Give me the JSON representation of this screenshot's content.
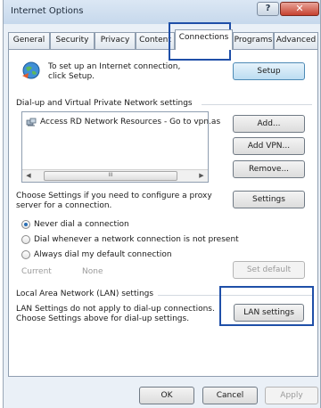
{
  "window": {
    "title": "Internet Options",
    "help_glyph": "?",
    "close_glyph": "✕"
  },
  "tabs": [
    {
      "label": "General"
    },
    {
      "label": "Security"
    },
    {
      "label": "Privacy"
    },
    {
      "label": "Content"
    },
    {
      "label": "Connections"
    },
    {
      "label": "Programs"
    },
    {
      "label": "Advanced"
    }
  ],
  "setup": {
    "text": "To set up an Internet connection, click Setup.",
    "button": "Setup"
  },
  "dialup": {
    "heading": "Dial-up and Virtual Private Network settings",
    "list_item": "Access RD Network Resources - Go to vpn.as",
    "scroll_thumb": "III",
    "add_button": "Add...",
    "add_vpn_button": "Add VPN...",
    "remove_button": "Remove...",
    "proxy_text": "Choose Settings if you need to configure a proxy server for a connection.",
    "settings_button": "Settings"
  },
  "radios": [
    {
      "label": "Never dial a connection",
      "checked": true
    },
    {
      "label": "Dial whenever a network connection is not present",
      "checked": false
    },
    {
      "label": "Always dial my default connection",
      "checked": false
    }
  ],
  "current": {
    "label": "Current",
    "value": "None",
    "set_default_button": "Set default"
  },
  "lan": {
    "heading": "Local Area Network (LAN) settings",
    "text": "LAN Settings do not apply to dial-up connections. Choose Settings above for dial-up settings.",
    "button": "LAN settings"
  },
  "footer": {
    "ok": "OK",
    "cancel": "Cancel",
    "apply": "Apply"
  },
  "colors": {
    "highlight": "#1f4fa8",
    "close_button": "#c6412f",
    "window_frame": "#eaf0f7"
  }
}
